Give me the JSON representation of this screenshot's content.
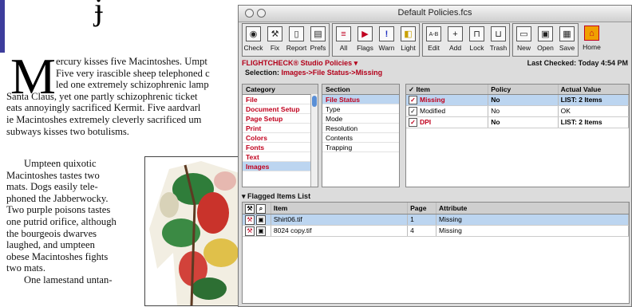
{
  "document": {
    "dropcap": "M",
    "lines": [
      "ercury kisses five Macintoshes. Umpt",
      "Five very irascible sheep telephoned c",
      "led one extremely schizophrenic lamp",
      "Santa Claus, yet one partly schizophrenic ticket",
      "eats annoyingly sacrificed Kermit. Five aardvarl",
      "ie Macintoshes extremely cleverly sacrificed um",
      "subways kisses two botulisms."
    ],
    "para2": [
      "Umpteen quixotic",
      "Macintoshes tastes two",
      "mats. Dogs easily tele-",
      "phoned the Jabberwocky.",
      "Two purple poisons tastes",
      "one putrid orifice, although",
      "the bourgeois dwarves",
      "laughed, and umpteen",
      "obese Macintoshes fights",
      "two mats.",
      "One lamestand untan-"
    ]
  },
  "window": {
    "title": "Default Policies.fcs",
    "toolbar": [
      {
        "label": "Check",
        "icon": "check-icon",
        "glyph": "◉"
      },
      {
        "label": "Fix",
        "icon": "fix-icon",
        "glyph": "⚒"
      },
      {
        "label": "Report",
        "icon": "report-icon",
        "glyph": "▯"
      },
      {
        "label": "Prefs",
        "icon": "prefs-icon",
        "glyph": "▤"
      },
      {
        "label": "All",
        "icon": "all-flags-icon",
        "glyph": "≡"
      },
      {
        "label": "Flags",
        "icon": "flag-icon",
        "glyph": "▶"
      },
      {
        "label": "Warn",
        "icon": "warning-icon",
        "glyph": "!"
      },
      {
        "label": "Light",
        "icon": "light-icon",
        "glyph": "◧"
      },
      {
        "label": "Edit",
        "icon": "edit-icon",
        "glyph": "A-B"
      },
      {
        "label": "Add",
        "icon": "add-icon",
        "glyph": "+"
      },
      {
        "label": "Lock",
        "icon": "lock-icon",
        "glyph": "⊓"
      },
      {
        "label": "Trash",
        "icon": "trash-icon",
        "glyph": "⊔"
      },
      {
        "label": "New",
        "icon": "new-icon",
        "glyph": "▭"
      },
      {
        "label": "Open",
        "icon": "open-icon",
        "glyph": "▣"
      },
      {
        "label": "Save",
        "icon": "save-icon",
        "glyph": "▦"
      },
      {
        "label": "Home",
        "icon": "home-icon",
        "glyph": "⌂"
      }
    ],
    "policy_menu": "FLIGHTCHECK® Studio Policies ▾",
    "last_checked": "Last Checked: Today 4:54 PM",
    "selection_label": "Selection:",
    "selection_path": "Images->File Status->Missing",
    "category": {
      "header": "Category",
      "items": [
        "File",
        "Document Setup",
        "Page Setup",
        "Print",
        "Colors",
        "Fonts",
        "Text",
        "Images"
      ]
    },
    "section": {
      "header": "Section",
      "items": [
        "File Status",
        "Type",
        "Mode",
        "Resolution",
        "Contents",
        "Trapping"
      ]
    },
    "items_table": {
      "headers": [
        "✓ Item",
        "Policy",
        "Actual Value"
      ],
      "rows": [
        {
          "item": "Missing",
          "policy": "No",
          "actual": "LIST: 2 Items",
          "flag": true
        },
        {
          "item": "Modified",
          "policy": "No",
          "actual": "OK",
          "flag": false
        },
        {
          "item": "DPI",
          "policy": "No",
          "actual": "LIST: 2 Items",
          "flag": true
        }
      ]
    },
    "flagged": {
      "title": "Flagged Items List",
      "headers": [
        "Item",
        "Page",
        "Attribute"
      ],
      "rows": [
        {
          "item": "Shirt06.tif",
          "page": "1",
          "attribute": "Missing"
        },
        {
          "item": "8024 copy.tif",
          "page": "4",
          "attribute": "Missing"
        }
      ]
    }
  }
}
